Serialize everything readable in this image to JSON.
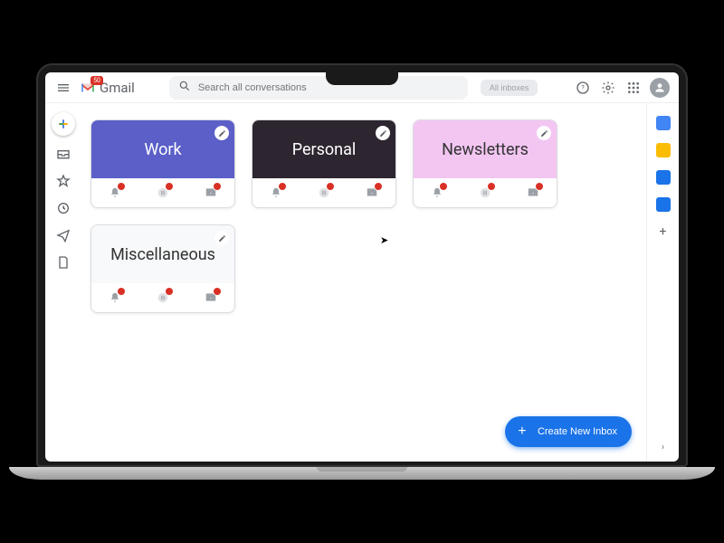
{
  "app": {
    "name": "Gmail",
    "unread_badge": "50"
  },
  "search": {
    "placeholder": "Search all conversations"
  },
  "filter_pill": {
    "label": "All inboxes"
  },
  "left_rail": {
    "items": [
      "compose",
      "inbox",
      "starred",
      "snoozed",
      "sent",
      "drafts"
    ]
  },
  "cards": [
    {
      "id": "work",
      "title": "Work",
      "style": "card-work",
      "counts": [
        "",
        "",
        ""
      ]
    },
    {
      "id": "personal",
      "title": "Personal",
      "style": "card-personal",
      "counts": [
        "",
        "",
        ""
      ]
    },
    {
      "id": "newsletters",
      "title": "Newsletters",
      "style": "card-news",
      "counts": [
        "",
        "",
        ""
      ]
    },
    {
      "id": "miscellaneous",
      "title": "Miscellaneous",
      "style": "card-misc",
      "counts": [
        "",
        "",
        ""
      ]
    }
  ],
  "fab": {
    "label": "Create New Inbox"
  },
  "right_rail": {
    "apps": [
      "calendar",
      "keep",
      "tasks",
      "contacts"
    ]
  }
}
